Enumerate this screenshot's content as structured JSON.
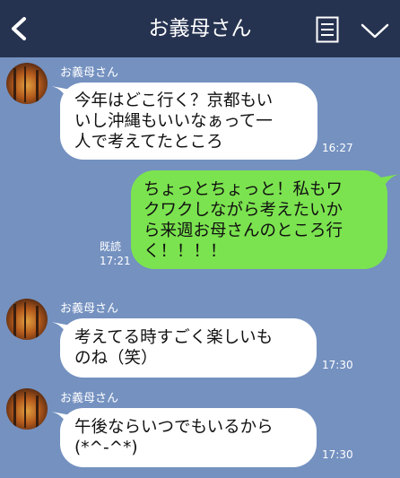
{
  "header": {
    "title": "お義母さん",
    "back_icon": "chevron-left-icon",
    "menu_icon": "document-list-icon",
    "expand_icon": "chevron-down-icon"
  },
  "messages": [
    {
      "sender": "お義母さん",
      "text": "今年はどこ行く？京都もい\nいし沖縄もいいなぁって一\n人で考えてたところ",
      "time": "16:27"
    },
    {
      "sender": "me",
      "text": "ちょっとちょっと！私もワ\nクワクしながら考えたいか\nら来週お母さんのところ行\nく！！！！",
      "read": "既読",
      "time": "17:21"
    },
    {
      "sender": "お義母さん",
      "text": "考えてる時すごく楽しいも\nのね（笑）",
      "time": "17:30"
    },
    {
      "sender": "お義母さん",
      "text": "午後ならいつでもいるから\n(*^-^*)",
      "time": "17:30"
    }
  ],
  "colors": {
    "background": "#7491c0",
    "header": "#263350",
    "bubble_left": "#ffffff",
    "bubble_right": "#7be34f"
  }
}
